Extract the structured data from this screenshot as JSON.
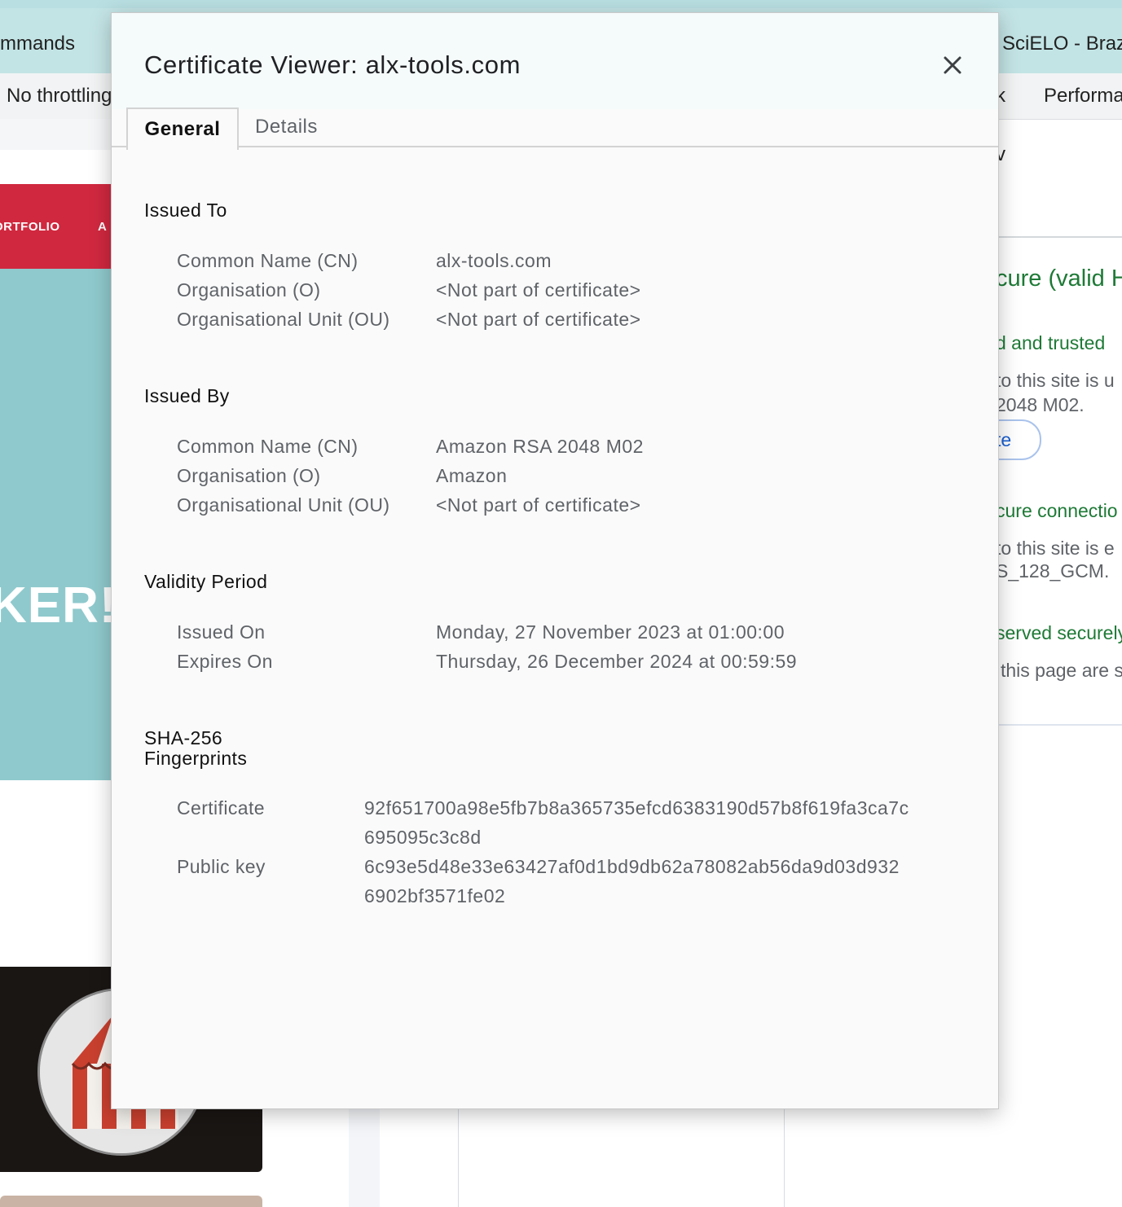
{
  "background": {
    "tab_left": "mmands",
    "tab_right": "SciELO - Braz",
    "toolbar_throttling": "No throttling",
    "toolbar_k": "k",
    "toolbar_performance": "Performa",
    "site_nav_portfolio": "ORTFOLIO",
    "site_nav_second": "A",
    "site_hero_text": "KER!",
    "security_v": "v",
    "security_title": "cure (valid H",
    "security_cert_heading": "d and trusted",
    "security_cert_line1": "to this site is u",
    "security_cert_line2": "2048 M02.",
    "security_cert_button": "te",
    "security_conn_heading": "cure connectio",
    "security_conn_line1": "to this site is e",
    "security_conn_line2": "S_128_GCM.",
    "security_res_heading": "served securely",
    "security_res_line1": "this page are s"
  },
  "dialog": {
    "title": "Certificate Viewer: alx-tools.com",
    "close_icon": "close-icon",
    "tabs": [
      {
        "label": "General",
        "selected": true
      },
      {
        "label": "Details",
        "selected": false
      }
    ],
    "issued_to": {
      "heading": "Issued To",
      "rows": [
        {
          "label": "Common Name (CN)",
          "value": "alx-tools.com"
        },
        {
          "label": "Organisation (O)",
          "value": "<Not part of certificate>"
        },
        {
          "label": "Organisational Unit (OU)",
          "value": "<Not part of certificate>"
        }
      ]
    },
    "issued_by": {
      "heading": "Issued By",
      "rows": [
        {
          "label": "Common Name (CN)",
          "value": "Amazon RSA 2048 M02"
        },
        {
          "label": "Organisation (O)",
          "value": "Amazon"
        },
        {
          "label": "Organisational Unit (OU)",
          "value": "<Not part of certificate>"
        }
      ]
    },
    "validity": {
      "heading": "Validity Period",
      "rows": [
        {
          "label": "Issued On",
          "value": "Monday, 27 November 2023 at 01:00:00"
        },
        {
          "label": "Expires On",
          "value": "Thursday, 26 December 2024 at 00:59:59"
        }
      ]
    },
    "fingerprints": {
      "heading_line1": "SHA-256",
      "heading_line2": "Fingerprints",
      "certificate_label": "Certificate",
      "certificate_line1": "92f651700a98e5fb7b8a365735efcd6383190d57b8f619fa3ca7c",
      "certificate_line2": "695095c3c8d",
      "public_key_label": "Public key",
      "public_key_line1": "6c93e5d48e33e63427af0d1bd9db62a78082ab56da9d03d932",
      "public_key_line2": "6902bf3571fe02"
    }
  }
}
